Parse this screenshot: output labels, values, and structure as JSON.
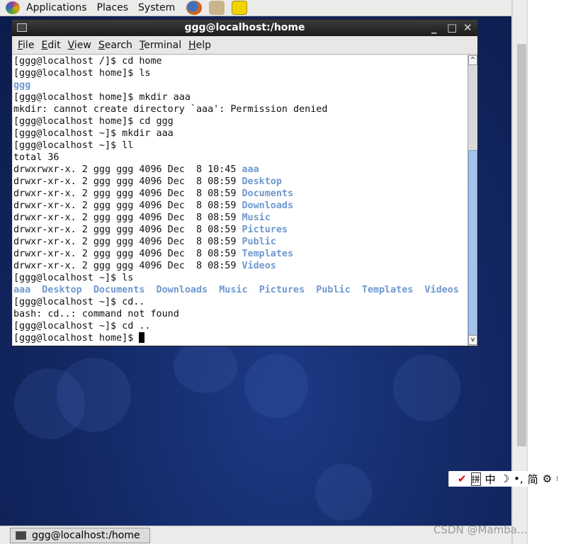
{
  "top_panel": {
    "menus": [
      "Applications",
      "Places",
      "System"
    ],
    "launchers": [
      "firefox-icon",
      "mail-icon",
      "notes-icon"
    ]
  },
  "window": {
    "title": "ggg@localhost:/home",
    "menu": [
      {
        "label": "File",
        "u": "F",
        "rest": "ile"
      },
      {
        "label": "Edit",
        "u": "E",
        "rest": "dit"
      },
      {
        "label": "View",
        "u": "V",
        "rest": "iew"
      },
      {
        "label": "Search",
        "u": "S",
        "rest": "earch"
      },
      {
        "label": "Terminal",
        "u": "T",
        "rest": "erminal"
      },
      {
        "label": "Help",
        "u": "H",
        "rest": "elp"
      }
    ]
  },
  "terminal": {
    "lines": [
      [
        [
          "[ggg@localhost /]$ cd home",
          ""
        ]
      ],
      [
        [
          "[ggg@localhost home]$ ls",
          ""
        ]
      ],
      [
        [
          "ggg",
          "b"
        ]
      ],
      [
        [
          "[ggg@localhost home]$ mkdir aaa",
          ""
        ]
      ],
      [
        [
          "mkdir: cannot create directory `aaa': Permission denied",
          ""
        ]
      ],
      [
        [
          "[ggg@localhost home]$ cd ggg",
          ""
        ]
      ],
      [
        [
          "[ggg@localhost ~]$ mkdir aaa",
          ""
        ]
      ],
      [
        [
          "[ggg@localhost ~]$ ll",
          ""
        ]
      ],
      [
        [
          "total 36",
          ""
        ]
      ],
      [
        [
          "drwxrwxr-x. 2 ggg ggg 4096 Dec  8 10:45 ",
          ""
        ],
        [
          "aaa",
          "b"
        ]
      ],
      [
        [
          "drwxr-xr-x. 2 ggg ggg 4096 Dec  8 08:59 ",
          ""
        ],
        [
          "Desktop",
          "b"
        ]
      ],
      [
        [
          "drwxr-xr-x. 2 ggg ggg 4096 Dec  8 08:59 ",
          ""
        ],
        [
          "Documents",
          "b"
        ]
      ],
      [
        [
          "drwxr-xr-x. 2 ggg ggg 4096 Dec  8 08:59 ",
          ""
        ],
        [
          "Downloads",
          "b"
        ]
      ],
      [
        [
          "drwxr-xr-x. 2 ggg ggg 4096 Dec  8 08:59 ",
          ""
        ],
        [
          "Music",
          "b"
        ]
      ],
      [
        [
          "drwxr-xr-x. 2 ggg ggg 4096 Dec  8 08:59 ",
          ""
        ],
        [
          "Pictures",
          "b"
        ]
      ],
      [
        [
          "drwxr-xr-x. 2 ggg ggg 4096 Dec  8 08:59 ",
          ""
        ],
        [
          "Public",
          "b"
        ]
      ],
      [
        [
          "drwxr-xr-x. 2 ggg ggg 4096 Dec  8 08:59 ",
          ""
        ],
        [
          "Templates",
          "b"
        ]
      ],
      [
        [
          "drwxr-xr-x. 2 ggg ggg 4096 Dec  8 08:59 ",
          ""
        ],
        [
          "Videos",
          "b"
        ]
      ],
      [
        [
          "[ggg@localhost ~]$ ls",
          ""
        ]
      ],
      [
        [
          "aaa  Desktop  Documents  Downloads  Music  Pictures  Public  Templates  Videos",
          "b"
        ]
      ],
      [
        [
          "[ggg@localhost ~]$ cd..",
          ""
        ]
      ],
      [
        [
          "bash: cd..: command not found",
          ""
        ]
      ],
      [
        [
          "[ggg@localhost ~]$ cd ..",
          ""
        ]
      ],
      [
        [
          "[ggg@localhost home]$ ",
          ""
        ]
      ]
    ]
  },
  "ime_toolbar": [
    "拼",
    "中",
    "☽",
    "•,",
    "简",
    "⚙"
  ],
  "taskbar": {
    "item": "ggg@localhost:/home"
  },
  "watermark": "CSDN @Mamba..."
}
